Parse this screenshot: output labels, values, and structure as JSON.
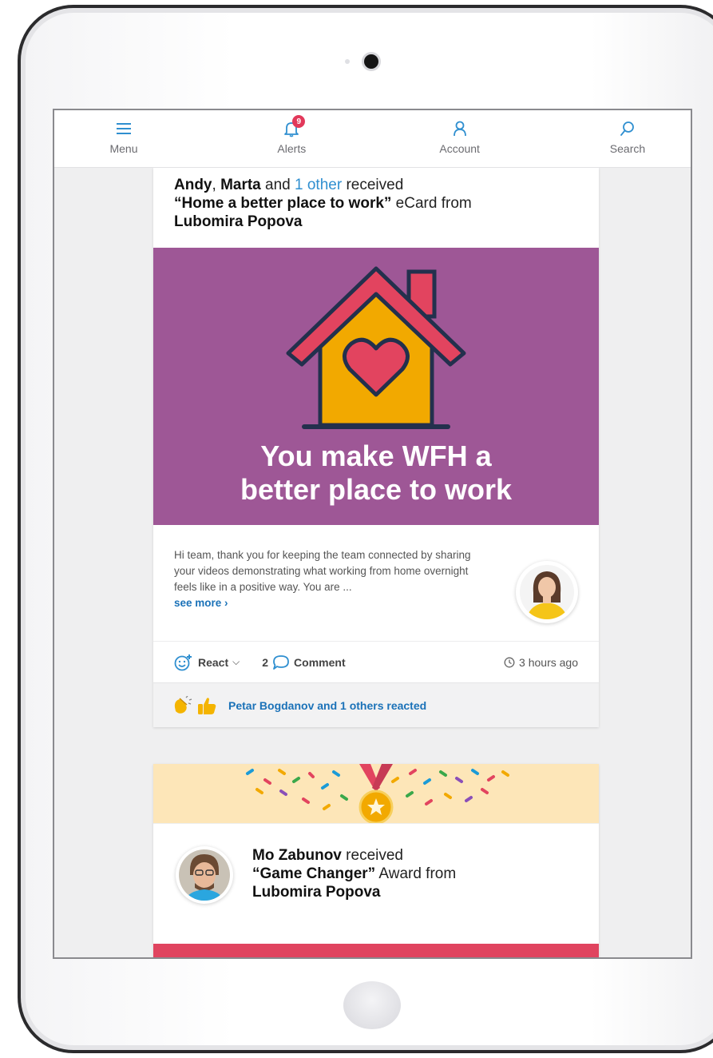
{
  "nav": {
    "menu_label": "Menu",
    "alerts_label": "Alerts",
    "alerts_count": "9",
    "account_label": "Account",
    "search_label": "Search",
    "menu_icon": "hamburger-icon",
    "alerts_icon": "bell-icon",
    "account_icon": "person-icon",
    "search_icon": "search-icon"
  },
  "post1": {
    "recipient_1": "Andy",
    "sep": ", ",
    "recipient_2": "Marta",
    "and_text": " and ",
    "others_link": "1 other",
    "received_text": " received",
    "card_name": "“Home a better place to work”",
    "card_type_text": " eCard from",
    "sender": "Lubomira Popova",
    "hero_line1": "You make WFH a",
    "hero_line2": "better place to work",
    "message": "Hi team, thank you for keeping the team connected by sharing your videos demonstrating what working from home overnight feels like in a positive way. You are ...",
    "see_more": "see more ›",
    "react_label": "React",
    "comment_count": "2",
    "comment_label": "Comment",
    "time": "3 hours ago",
    "reactions_text": "Petar Bogdanov and 1 others reacted"
  },
  "post2": {
    "recipient": "Mo Zabunov",
    "received_text": " received",
    "award_name": "“Game Changer”",
    "award_type_text": " Award from",
    "sender": "Lubomira Popova"
  },
  "colors": {
    "accent": "#2f8fd0",
    "hero_bg": "#9e5796",
    "house": "#f2a900",
    "roof": "#e2445f",
    "badge": "#e2385a"
  }
}
